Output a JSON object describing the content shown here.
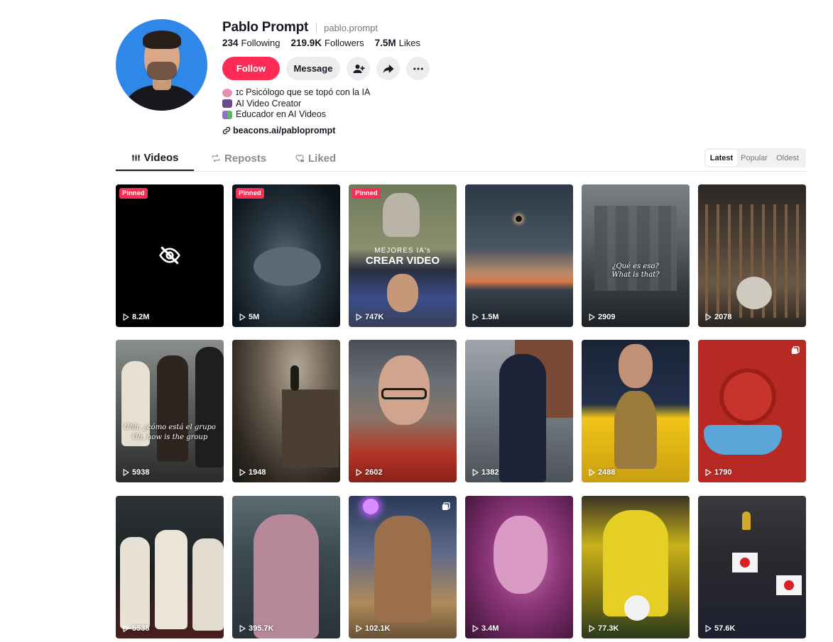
{
  "profile": {
    "display_name": "Pablo Prompt",
    "username": "pablo.prompt",
    "following_count": "234",
    "following_label": "Following",
    "followers_count": "219.9K",
    "followers_label": "Followers",
    "likes_count": "7.5M",
    "likes_label": "Likes",
    "follow_label": "Follow",
    "message_label": "Message",
    "bio": [
      {
        "icon": "brain-emoji",
        "color": "#e58fb8",
        "text": "ɪc Psicólogo que se topó con la IA"
      },
      {
        "icon": "movie-camera-emoji",
        "color": "#6b4b8a",
        "text": "AI Video Creator"
      },
      {
        "icon": "books-emoji",
        "color": "#8f6fd0",
        "text": "Educador en AI Videos"
      }
    ],
    "link": "beacons.ai/pabloprompt"
  },
  "tabs": {
    "videos": "Videos",
    "reposts": "Reposts",
    "liked": "Liked"
  },
  "sort": {
    "latest": "Latest",
    "popular": "Popular",
    "oldest": "Oldest",
    "active": "Latest"
  },
  "videos": [
    {
      "views": "8.2M",
      "pinned": "Pinned",
      "hidden": true
    },
    {
      "views": "5M",
      "pinned": "Pinned"
    },
    {
      "views": "747K",
      "pinned": "Pinned",
      "caption_top": "MEJORES IA's",
      "caption_main": "CREAR VIDEO"
    },
    {
      "views": "1.5M"
    },
    {
      "views": "2909",
      "caption": "¿Qué es eso?",
      "caption2": "What is that?"
    },
    {
      "views": "2078"
    },
    {
      "views": "5938",
      "caption": "Uhh, ¿cómo está el grupo",
      "caption2": "Uh, how is the group"
    },
    {
      "views": "1948"
    },
    {
      "views": "2602"
    },
    {
      "views": "1382"
    },
    {
      "views": "2488"
    },
    {
      "views": "1790",
      "multi": true
    },
    {
      "views": "5538"
    },
    {
      "views": "395.7K"
    },
    {
      "views": "102.1K",
      "multi": true
    },
    {
      "views": "3.4M"
    },
    {
      "views": "77.3K"
    },
    {
      "views": "57.6K"
    }
  ],
  "colors": {
    "accent": "#fe2c55",
    "text": "#161823",
    "muted": "#8a8b91"
  }
}
